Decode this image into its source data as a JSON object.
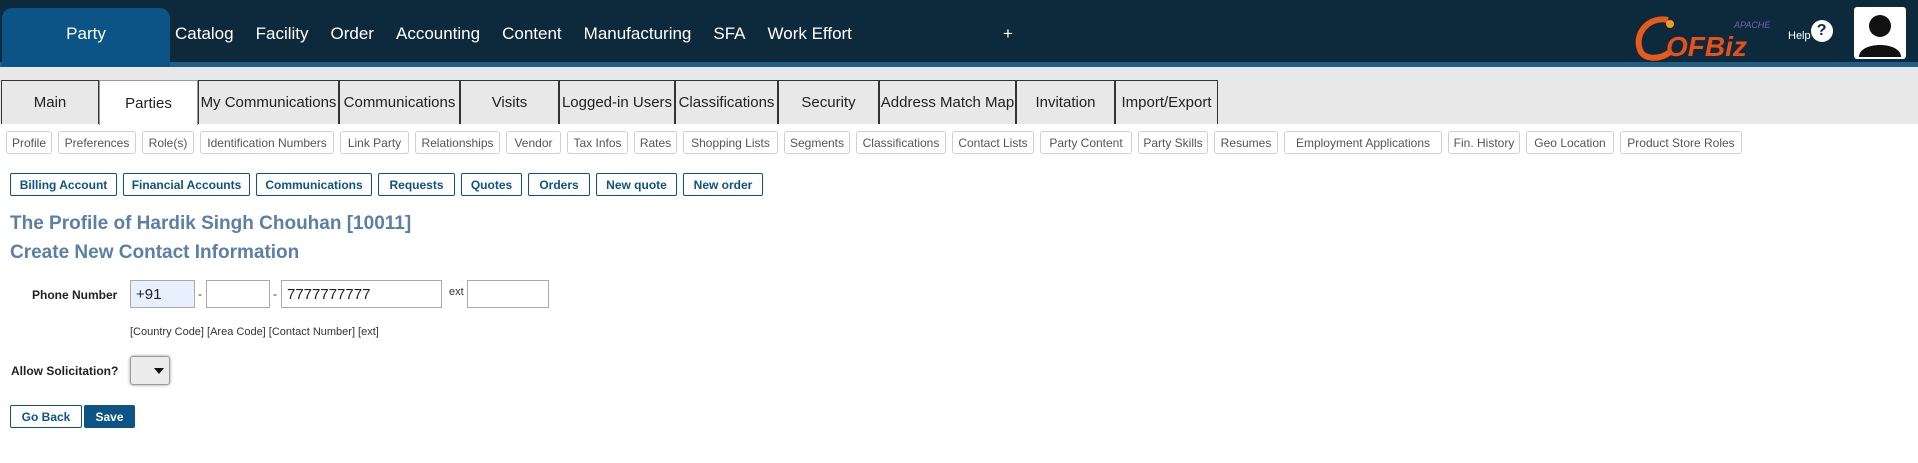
{
  "app_nav": {
    "active": "Party",
    "items": [
      "Catalog",
      "Facility",
      "Order",
      "Accounting",
      "Content",
      "Manufacturing",
      "SFA",
      "Work Effort"
    ],
    "plus": "+",
    "logo_top": "APACHE",
    "logo_main": "OFBiz",
    "help_label": "Help",
    "help_icon": "?"
  },
  "sub_tabs": [
    "Main",
    "Parties",
    "My Communications",
    "Communications",
    "Visits",
    "Logged-in Users",
    "Classifications",
    "Security",
    "Address Match Map",
    "Invitation",
    "Import/Export"
  ],
  "party_nav": [
    "Profile",
    "Preferences",
    "Role(s)",
    "Identification Numbers",
    "Link Party",
    "Relationships",
    "Vendor",
    "Tax Infos",
    "Rates",
    "Shopping Lists",
    "Segments",
    "Classifications",
    "Contact Lists",
    "Party Content",
    "Party Skills",
    "Resumes",
    "Employment Applications",
    "Fin. History",
    "Geo Location",
    "Product Store Roles"
  ],
  "actions": [
    "Billing Account",
    "Financial Accounts",
    "Communications",
    "Requests",
    "Quotes",
    "Orders",
    "New quote",
    "New order"
  ],
  "page": {
    "title": "The Profile of Hardik Singh Chouhan [10011]",
    "subtitle": "Create New Contact Information"
  },
  "form": {
    "phone_label": "Phone Number",
    "country_code": "+91",
    "area_code": "",
    "contact_number": "7777777777",
    "ext_label": "ext",
    "ext": "",
    "dash": "-",
    "hint": "[Country Code] [Area Code] [Contact Number] [ext]",
    "solicitation_label": "Allow Solicitation?",
    "solicitation_value": ""
  },
  "buttons": {
    "back": "Go Back",
    "save": "Save"
  }
}
